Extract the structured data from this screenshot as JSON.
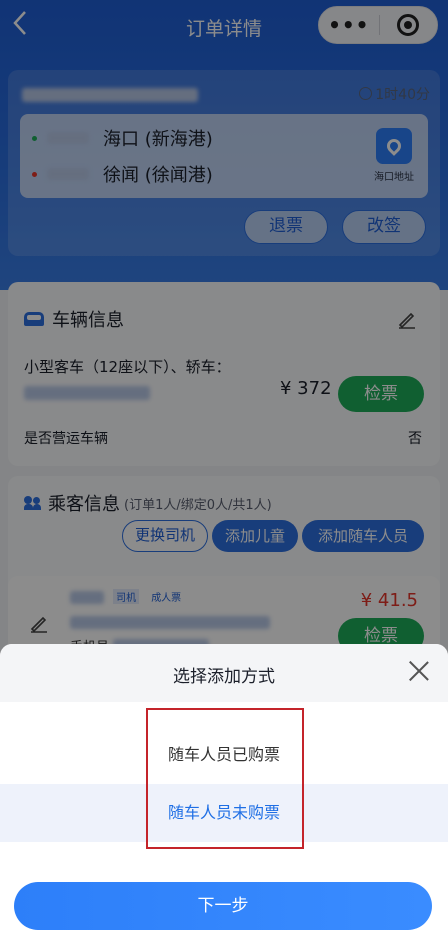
{
  "nav": {
    "title": "订单详情",
    "back_icon": "back-chevron-icon",
    "menu_icon": "more-dots-icon",
    "target_icon": "target-icon"
  },
  "trip": {
    "duration": "1时40分",
    "stops": [
      {
        "name": "海口 (新海港)",
        "dot_color": "#1eae5a"
      },
      {
        "name": "徐闻 (徐闻港)",
        "dot_color": "#e5352b"
      }
    ],
    "map_label": "海口地址",
    "refund_label": "退票",
    "change_label": "改签"
  },
  "vehicle": {
    "title": "车辆信息",
    "desc": "小型客车（12座以下）、轿车：",
    "price": "¥ 372",
    "check_label": "检票",
    "operating_label": "是否营运车辆",
    "operating_value": "否"
  },
  "passengers": {
    "title": "乘客信息",
    "counts": "(订单1人/绑定0人/共1人)",
    "change_driver": "更换司机",
    "add_child": "添加儿童",
    "add_companion": "添加随车人员",
    "tag_driver": "司机",
    "tag_adult": "成人票",
    "price": "¥ 41.5",
    "check_label": "检票",
    "phone_prefix": "手机号 "
  },
  "sheet": {
    "title": "选择添加方式",
    "options": [
      {
        "label": "随车人员已购票",
        "color": "#333333"
      },
      {
        "label": "随车人员未购票",
        "color": "#1f6fe5"
      }
    ],
    "next_label": "下一步"
  },
  "colors": {
    "accent": "#2d6fe0",
    "green": "#1eae5a",
    "red": "#e5352b",
    "highlight": "#c4242a"
  }
}
